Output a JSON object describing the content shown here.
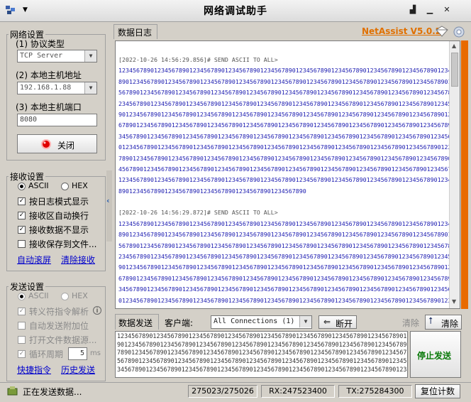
{
  "window": {
    "title": "网络调试助手"
  },
  "app": {
    "brand": "NetAssist V5.0.2"
  },
  "net": {
    "legend": "网络设置",
    "protocol_label": "(1) 协议类型",
    "protocol_value": "TCP Server",
    "host_label": "(2) 本地主机地址",
    "host_value": "192.168.1.88",
    "port_label": "(3) 本地主机端口",
    "port_value": "8080",
    "close_button": "关闭"
  },
  "recv": {
    "legend": "接收设置",
    "ascii": "ASCII",
    "hex": "HEX",
    "opt1": "按日志模式显示",
    "opt2": "接收区自动换行",
    "opt3": "接收数据不显示",
    "opt4": "接收保存到文件...",
    "auto_scroll": "自动滚屏",
    "clear_recv": "清除接收"
  },
  "send": {
    "legend": "发送设置",
    "ascii": "ASCII",
    "hex": "HEX",
    "opt1": "转义符指令解析",
    "opt2": "自动发送附加位",
    "opt3": "打开文件数据源...",
    "opt4": "循环周期",
    "period": "5",
    "unit": "ms",
    "shortcut": "快捷指令",
    "history": "历史发送"
  },
  "tabs": {
    "log": "数据日志",
    "send": "数据发送"
  },
  "log": {
    "entries": [
      {
        "header": "[2022-10-26 14:56:29.856]# SEND ASCII TO ALL>",
        "lines": [
          "1234567890123456789012345678901234567890123456789012345678901234567890123456789012345678901234567",
          "8901234567890123456789012345678901234567890123456789012345678901234567890123456789012345678901234",
          "5678901234567890123456789012345678901234567890123456789012345678901234567890123456789012345678901",
          "2345678901234567890123456789012345678901234567890123456789012345678901234567890123456789012345678",
          "9012345678901234567890123456789012345678901234567890123456789012345678901234567890123456789012345",
          "6789012345678901234567890123456789012345678901234567890123456789012345678901234567890123456789012",
          "3456789012345678901234567890123456789012345678901234567890123456789012345678901234567890123456789",
          "0123456789012345678901234567890123456789012345678901234567890123456789012345678901234567890123456",
          "7890123456789012345678901234567890123456789012345678901234567890123456789012345678901234567890123",
          "4567890123456789012345678901234567890123456789012345678901234567890123456789012345678901234567890",
          "1234567890123456789012345678901234567890123456789012345678901234567890123456789012345678901234567",
          "89012345678901234567890123456789012345678901234567890"
        ]
      },
      {
        "header": "[2022-10-26 14:56:29.872]# SEND ASCII TO ALL>",
        "lines": [
          "1234567890123456789012345678901234567890123456789012345678901234567890123456789012345678901234567",
          "8901234567890123456789012345678901234567890123456789012345678901234567890123456789012345678901234",
          "5678901234567890123456789012345678901234567890123456789012345678901234567890123456789012345678901",
          "2345678901234567890123456789012345678901234567890123456789012345678901234567890123456789012345678",
          "9012345678901234567890123456789012345678901234567890123456789012345678901234567890123456789012345",
          "6789012345678901234567890123456789012345678901234567890123456789012345678901234567890123456789012",
          "3456789012345678901234567890123456789012345678901234567890123456789012345678901234567890123456789",
          "0123456789012345678901234567890123456789012345678901234567890123456789012345678901234567890123456"
        ]
      }
    ]
  },
  "sendbar": {
    "client_label": "客户端:",
    "client_value": "All Connections (1)",
    "disconnect": "断开",
    "clear_disabled": "清除",
    "clear": "清除",
    "stop_send": "停止发送",
    "lines": [
      "1234567890123456789012345678901234567890123456789012345678901234567890123456789012345678",
      "9012345678901234567890123456789012345678901234567890123456789012345678901234567890123456",
      "7890123456789012345678901234567890123456789012345678901234567890123456789012345678901234",
      "5678901234567890123456789012345678901234567890123456789012345678901234567890123456789012",
      "3456789012345678901234567890123456789012345678901234567890123456789012345678901234567890"
    ]
  },
  "status": {
    "message": "正在发送数据...",
    "counter": "275023/275026",
    "rx": "RX:247523400",
    "tx": "TX:275284300",
    "reset": "复位计数"
  },
  "colors": {
    "log_text": "#1a1ab0",
    "brand": "#e07000",
    "stop_send": "#0a7a0a",
    "close_led": "#e00000"
  }
}
